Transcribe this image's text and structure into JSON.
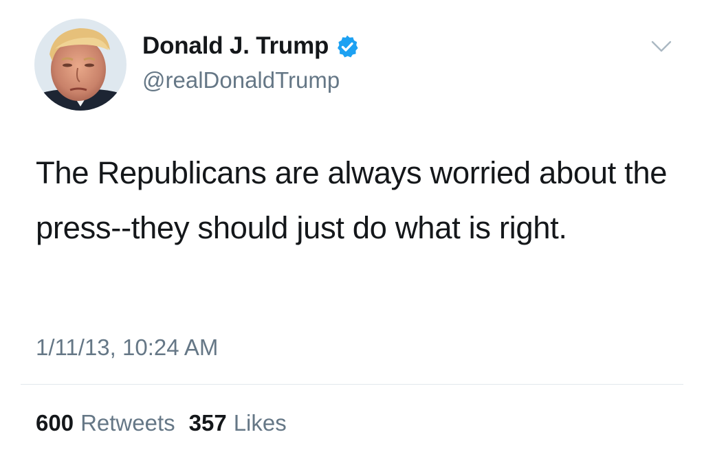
{
  "author": {
    "display_name": "Donald J. Trump",
    "handle": "@realDonaldTrump",
    "verified_icon": "verified-badge-icon",
    "avatar_icon": "profile-avatar"
  },
  "menu": {
    "icon": "chevron-down-icon"
  },
  "tweet": {
    "text": "The Republicans are always worried about the press--they should just do what is right.",
    "timestamp": "1/11/13, 10:24 AM"
  },
  "stats": {
    "retweets_count": "600",
    "retweets_label": "Retweets",
    "likes_count": "357",
    "likes_label": "Likes"
  },
  "colors": {
    "text_primary": "#14171a",
    "text_secondary": "#657786",
    "verified_blue": "#1da1f2",
    "divider": "#e1e8ed"
  }
}
